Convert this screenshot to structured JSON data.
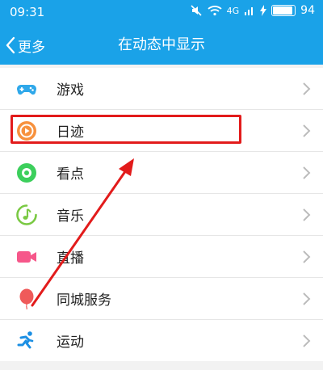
{
  "status_bar": {
    "time": "09:31",
    "signal_label": "4G",
    "battery_percent": "94",
    "battery_level": 0.94
  },
  "header": {
    "back_label": "更多",
    "title": "在动态中显示"
  },
  "items": [
    {
      "label": "游戏",
      "icon": "gamepad-icon",
      "color": "#2fa8ea"
    },
    {
      "label": "日迹",
      "icon": "play-circle-icon",
      "color": "#f7913d"
    },
    {
      "label": "看点",
      "icon": "eye-icon",
      "color": "#3ccf5c"
    },
    {
      "label": "音乐",
      "icon": "music-note-icon",
      "color": "#7ac943"
    },
    {
      "label": "直播",
      "icon": "video-camera-icon",
      "color": "#f6578a"
    },
    {
      "label": "同城服务",
      "icon": "balloon-icon",
      "color": "#ef5a5a"
    },
    {
      "label": "运动",
      "icon": "running-icon",
      "color": "#1c8fe3"
    }
  ],
  "colors": {
    "accent": "#1aa2e8",
    "highlight": "#e21b1b"
  }
}
